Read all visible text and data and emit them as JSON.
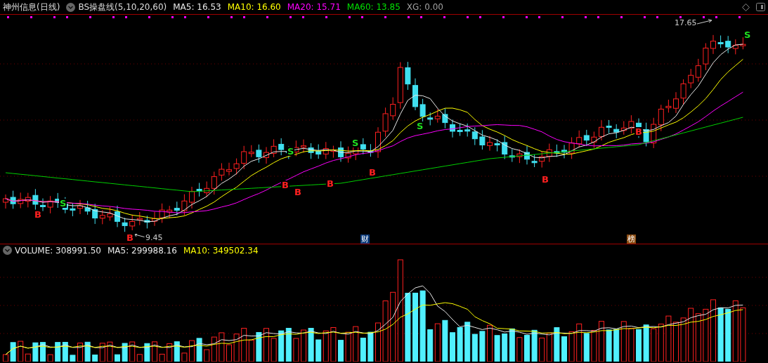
{
  "header": {
    "stock_name": "神州信息(日线)",
    "indicator": "BS操盘线(5,10,20,60)",
    "values": [
      {
        "label": "MA5: 16.53",
        "color": "#e8e8e8"
      },
      {
        "label": "MA10: 16.60",
        "color": "#ffff00"
      },
      {
        "label": "MA20: 15.71",
        "color": "#ff00ff"
      },
      {
        "label": "MA60: 13.85",
        "color": "#00e000"
      },
      {
        "label": "XG: 0.00",
        "color": "#a0a0a0"
      }
    ]
  },
  "price_panel": {
    "high_label": "17.65",
    "low_label": "9.45",
    "markers": [
      {
        "kind": "buy",
        "label": "B"
      },
      {
        "kind": "sell",
        "label": "S"
      },
      {
        "kind": "buy",
        "label": "B"
      },
      {
        "kind": "sell",
        "label": "S"
      },
      {
        "kind": "buy",
        "label": "B"
      },
      {
        "kind": "buy",
        "label": "B"
      },
      {
        "kind": "buy",
        "label": "B"
      },
      {
        "kind": "sell",
        "label": "S"
      },
      {
        "kind": "buy",
        "label": "B"
      },
      {
        "kind": "sell",
        "label": "S"
      },
      {
        "kind": "buy",
        "label": "B"
      },
      {
        "kind": "buy",
        "label": "B"
      },
      {
        "kind": "sell",
        "label": "S"
      }
    ],
    "badges": [
      {
        "kind": "finance",
        "label": "财"
      },
      {
        "kind": "ranking",
        "label": "榜"
      }
    ]
  },
  "volume_panel": {
    "values": [
      {
        "label": "VOLUME: 308991.50",
        "color": "#e8e8e8"
      },
      {
        "label": "MA5: 299988.16",
        "color": "#e8e8e8"
      },
      {
        "label": "MA10: 349502.34",
        "color": "#ffff00"
      }
    ]
  }
}
